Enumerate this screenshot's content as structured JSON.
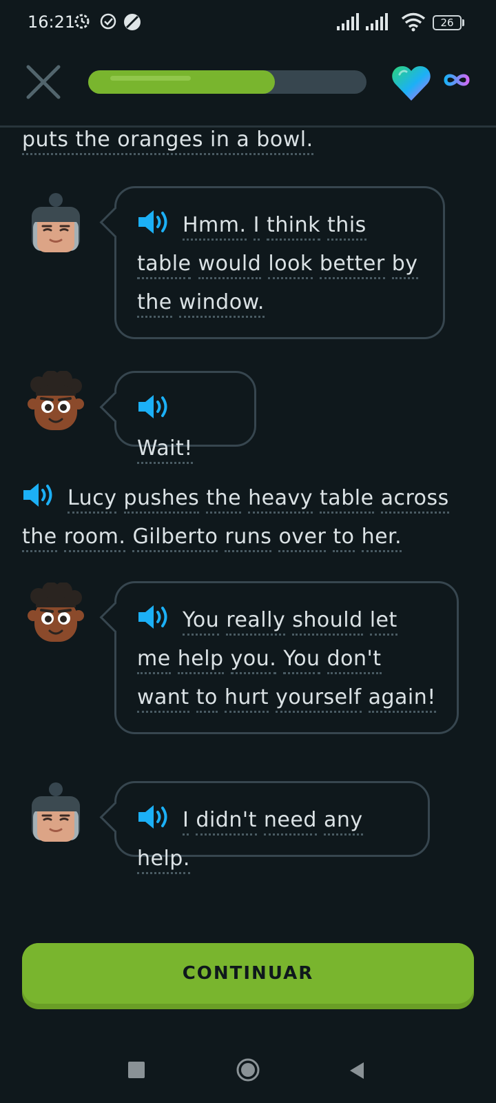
{
  "status_bar": {
    "time": "16:21",
    "battery": "26"
  },
  "top_bar": {
    "progress_fraction": 0.67,
    "colors": {
      "progress": "#79b52e",
      "track": "#37464f"
    }
  },
  "dialogue": {
    "narration_top": "puts the oranges in a bowl.",
    "line1": {
      "words": [
        "Hmm.",
        "I",
        "think",
        "this",
        "table",
        "would",
        "look",
        "better",
        "by",
        "the",
        "window."
      ]
    },
    "line2": {
      "words": [
        "Wait!"
      ]
    },
    "narration_mid": {
      "words": [
        "Lucy",
        "pushes",
        "the",
        "heavy",
        "table",
        "across",
        "the",
        "room.",
        "Gilberto",
        "runs",
        "over",
        "to",
        "her."
      ]
    },
    "line3": {
      "words": [
        "You",
        "really",
        "should",
        "let",
        "me",
        "help",
        "you.",
        "You",
        "don't",
        "want",
        "to",
        "hurt",
        "yourself",
        "again!"
      ]
    },
    "line4": {
      "words": [
        "I",
        "didn't",
        "need",
        "any",
        "help."
      ]
    }
  },
  "continue_button": {
    "label": "CONTINUAR"
  },
  "colors": {
    "background": "#0f181c",
    "accent": "#79b52e",
    "speaker": "#1cb0f6"
  }
}
